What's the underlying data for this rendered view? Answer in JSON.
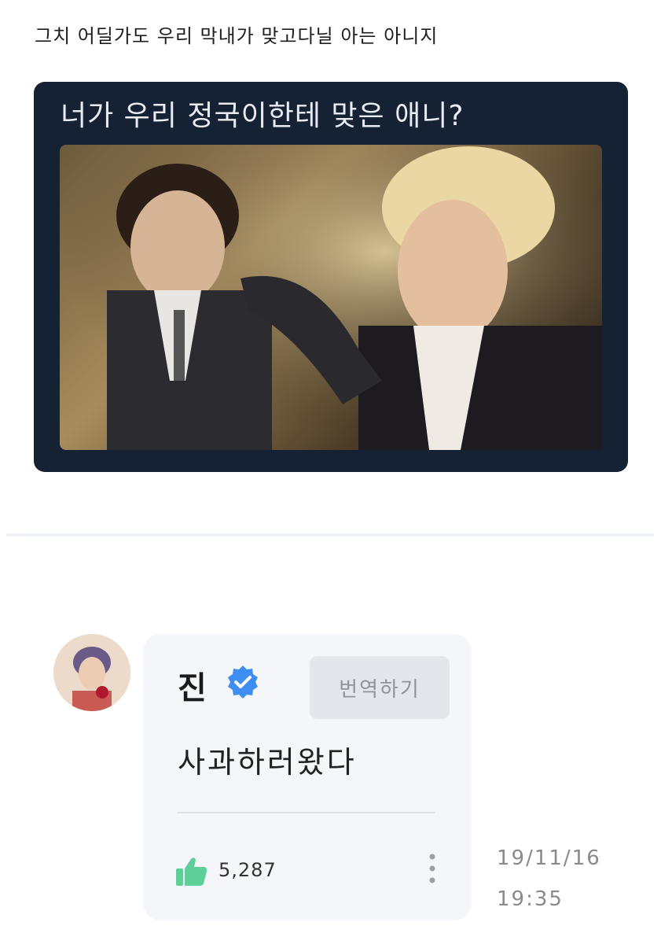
{
  "caption": "그치 어딜가도 우리 막내가 맞고다닐 아는 아니지",
  "meme": {
    "title": "너가 우리 정국이한테 맞은 애니?",
    "background_color": "#152233"
  },
  "post": {
    "author": "진",
    "translate_label": "번역하기",
    "text": "사과하러왔다",
    "like_count": "5,287",
    "date": "19/11/16",
    "time": "19:35",
    "verified_color": "#3d8ef0",
    "like_color": "#5fcf9a"
  }
}
